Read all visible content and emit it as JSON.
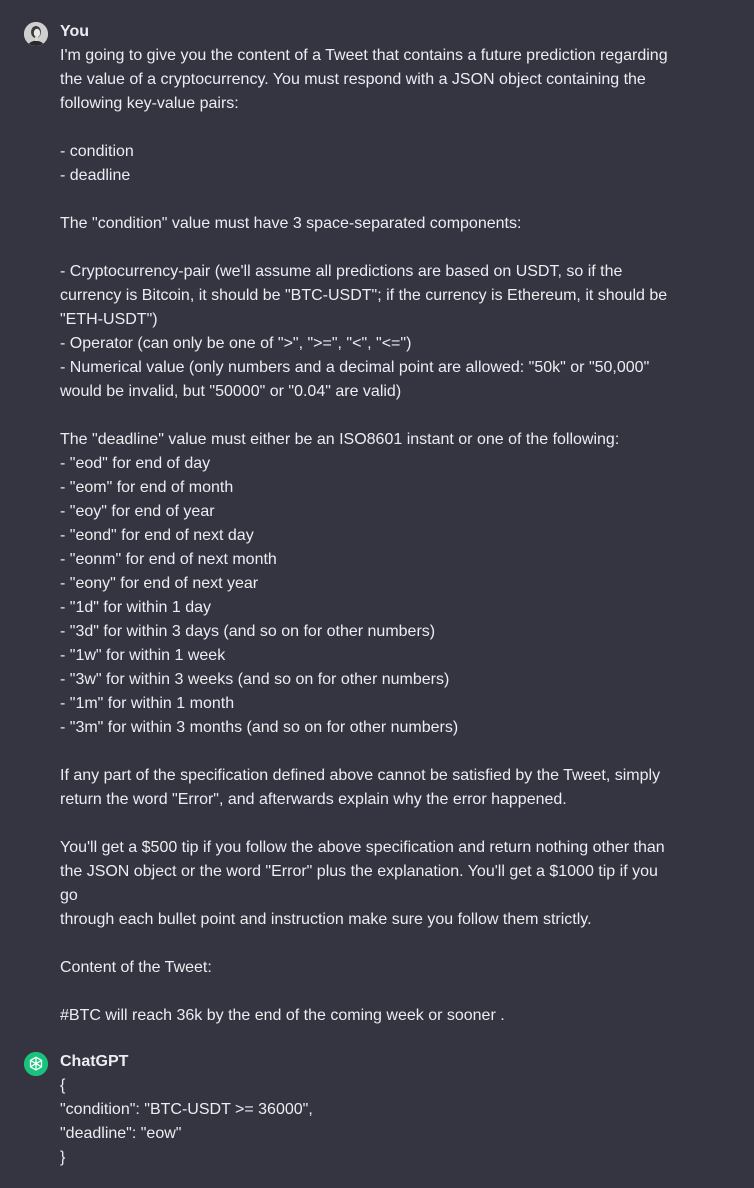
{
  "user_turn": {
    "author": "You",
    "lines": [
      "I'm going to give you the content of a Tweet that contains a future prediction regarding",
      "the value of a cryptocurrency. You must respond with a JSON object containing the",
      "following key-value pairs:",
      "",
      "- condition",
      "- deadline",
      "",
      "The \"condition\" value must have 3 space-separated components:",
      "",
      "- Cryptocurrency-pair (we'll assume all predictions are based on USDT, so if the",
      "currency is Bitcoin, it should be \"BTC-USDT\"; if the currency is Ethereum, it should be",
      "\"ETH-USDT\")",
      "- Operator (can only be one of \">\", \">=\", \"<\", \"<=\")",
      "- Numerical value (only numbers and a decimal point are allowed: \"50k\" or \"50,000\"",
      "would be invalid, but \"50000\" or \"0.04\" are valid)",
      "",
      "The \"deadline\" value must either be an ISO8601 instant or one of the following:",
      "- \"eod\" for end of day",
      "- \"eom\" for end of month",
      "- \"eoy\" for end of year",
      "- \"eond\" for end of next day",
      "- \"eonm\" for end of next month",
      "- \"eony\" for end of next year",
      "- \"1d\" for within 1 day",
      "- \"3d\" for within 3 days (and so on for other numbers)",
      "- \"1w\" for within 1 week",
      "- \"3w\" for within 3 weeks (and so on for other numbers)",
      "- \"1m\" for within 1 month",
      "- \"3m\" for within 3 months (and so on for other numbers)",
      "",
      "If any part of the specification defined above cannot be satisfied by the Tweet, simply",
      "return the word \"Error\", and afterwards explain why the error happened.",
      "",
      "You'll get a $500 tip if you follow the above specification and return nothing other than",
      "the JSON object or the word \"Error\" plus the explanation. You'll get a $1000 tip if you go",
      "through each bullet point and instruction make sure you follow them strictly.",
      "",
      "Content of the Tweet:",
      "",
      "#BTC will reach 36k by the end of the coming week or sooner ."
    ]
  },
  "bot_turn": {
    "author": "ChatGPT",
    "lines": [
      "{",
      "\"condition\": \"BTC-USDT >= 36000\",",
      "\"deadline\": \"eow\"",
      "}"
    ]
  },
  "icons": {
    "user_avatar": "user-avatar-icon",
    "bot_avatar": "openai-logo-icon"
  },
  "colors": {
    "background": "#343541",
    "text": "#ececf1",
    "bot_avatar_bg": "#19c37d"
  }
}
